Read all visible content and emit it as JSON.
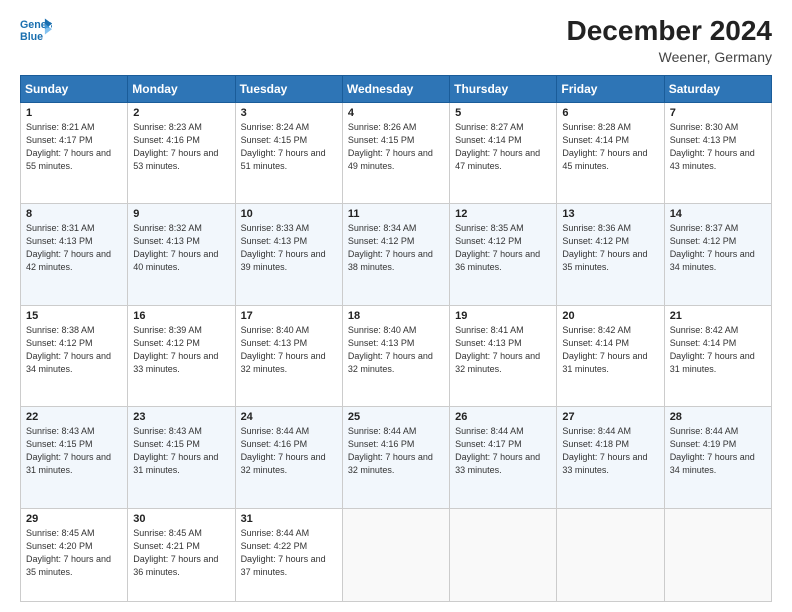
{
  "header": {
    "logo_line1": "General",
    "logo_line2": "Blue",
    "title": "December 2024",
    "subtitle": "Weener, Germany"
  },
  "weekdays": [
    "Sunday",
    "Monday",
    "Tuesday",
    "Wednesday",
    "Thursday",
    "Friday",
    "Saturday"
  ],
  "weeks": [
    [
      {
        "day": "1",
        "sunrise": "8:21 AM",
        "sunset": "4:17 PM",
        "daylight": "7 hours and 55 minutes."
      },
      {
        "day": "2",
        "sunrise": "8:23 AM",
        "sunset": "4:16 PM",
        "daylight": "7 hours and 53 minutes."
      },
      {
        "day": "3",
        "sunrise": "8:24 AM",
        "sunset": "4:15 PM",
        "daylight": "7 hours and 51 minutes."
      },
      {
        "day": "4",
        "sunrise": "8:26 AM",
        "sunset": "4:15 PM",
        "daylight": "7 hours and 49 minutes."
      },
      {
        "day": "5",
        "sunrise": "8:27 AM",
        "sunset": "4:14 PM",
        "daylight": "7 hours and 47 minutes."
      },
      {
        "day": "6",
        "sunrise": "8:28 AM",
        "sunset": "4:14 PM",
        "daylight": "7 hours and 45 minutes."
      },
      {
        "day": "7",
        "sunrise": "8:30 AM",
        "sunset": "4:13 PM",
        "daylight": "7 hours and 43 minutes."
      }
    ],
    [
      {
        "day": "8",
        "sunrise": "8:31 AM",
        "sunset": "4:13 PM",
        "daylight": "7 hours and 42 minutes."
      },
      {
        "day": "9",
        "sunrise": "8:32 AM",
        "sunset": "4:13 PM",
        "daylight": "7 hours and 40 minutes."
      },
      {
        "day": "10",
        "sunrise": "8:33 AM",
        "sunset": "4:13 PM",
        "daylight": "7 hours and 39 minutes."
      },
      {
        "day": "11",
        "sunrise": "8:34 AM",
        "sunset": "4:12 PM",
        "daylight": "7 hours and 38 minutes."
      },
      {
        "day": "12",
        "sunrise": "8:35 AM",
        "sunset": "4:12 PM",
        "daylight": "7 hours and 36 minutes."
      },
      {
        "day": "13",
        "sunrise": "8:36 AM",
        "sunset": "4:12 PM",
        "daylight": "7 hours and 35 minutes."
      },
      {
        "day": "14",
        "sunrise": "8:37 AM",
        "sunset": "4:12 PM",
        "daylight": "7 hours and 34 minutes."
      }
    ],
    [
      {
        "day": "15",
        "sunrise": "8:38 AM",
        "sunset": "4:12 PM",
        "daylight": "7 hours and 34 minutes."
      },
      {
        "day": "16",
        "sunrise": "8:39 AM",
        "sunset": "4:12 PM",
        "daylight": "7 hours and 33 minutes."
      },
      {
        "day": "17",
        "sunrise": "8:40 AM",
        "sunset": "4:13 PM",
        "daylight": "7 hours and 32 minutes."
      },
      {
        "day": "18",
        "sunrise": "8:40 AM",
        "sunset": "4:13 PM",
        "daylight": "7 hours and 32 minutes."
      },
      {
        "day": "19",
        "sunrise": "8:41 AM",
        "sunset": "4:13 PM",
        "daylight": "7 hours and 32 minutes."
      },
      {
        "day": "20",
        "sunrise": "8:42 AM",
        "sunset": "4:14 PM",
        "daylight": "7 hours and 31 minutes."
      },
      {
        "day": "21",
        "sunrise": "8:42 AM",
        "sunset": "4:14 PM",
        "daylight": "7 hours and 31 minutes."
      }
    ],
    [
      {
        "day": "22",
        "sunrise": "8:43 AM",
        "sunset": "4:15 PM",
        "daylight": "7 hours and 31 minutes."
      },
      {
        "day": "23",
        "sunrise": "8:43 AM",
        "sunset": "4:15 PM",
        "daylight": "7 hours and 31 minutes."
      },
      {
        "day": "24",
        "sunrise": "8:44 AM",
        "sunset": "4:16 PM",
        "daylight": "7 hours and 32 minutes."
      },
      {
        "day": "25",
        "sunrise": "8:44 AM",
        "sunset": "4:16 PM",
        "daylight": "7 hours and 32 minutes."
      },
      {
        "day": "26",
        "sunrise": "8:44 AM",
        "sunset": "4:17 PM",
        "daylight": "7 hours and 33 minutes."
      },
      {
        "day": "27",
        "sunrise": "8:44 AM",
        "sunset": "4:18 PM",
        "daylight": "7 hours and 33 minutes."
      },
      {
        "day": "28",
        "sunrise": "8:44 AM",
        "sunset": "4:19 PM",
        "daylight": "7 hours and 34 minutes."
      }
    ],
    [
      {
        "day": "29",
        "sunrise": "8:45 AM",
        "sunset": "4:20 PM",
        "daylight": "7 hours and 35 minutes."
      },
      {
        "day": "30",
        "sunrise": "8:45 AM",
        "sunset": "4:21 PM",
        "daylight": "7 hours and 36 minutes."
      },
      {
        "day": "31",
        "sunrise": "8:44 AM",
        "sunset": "4:22 PM",
        "daylight": "7 hours and 37 minutes."
      },
      null,
      null,
      null,
      null
    ]
  ]
}
